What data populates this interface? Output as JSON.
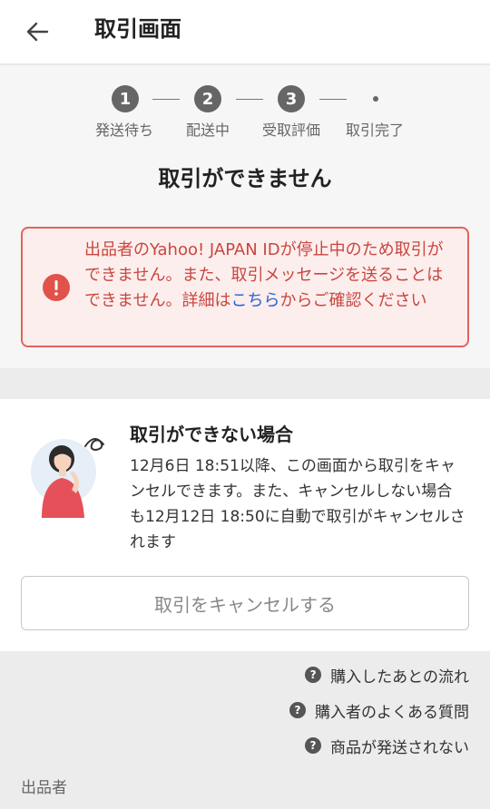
{
  "header": {
    "title": "取引画面"
  },
  "steps": [
    {
      "number": "1",
      "label": "発送待ち"
    },
    {
      "number": "2",
      "label": "配送中"
    },
    {
      "number": "3",
      "label": "受取評価"
    },
    {
      "number": "",
      "label": "取引完了"
    }
  ],
  "status_title": "取引ができません",
  "error": {
    "text_before": "出品者のYahoo! JAPAN IDが停止中のため取引ができません。また、取引メッセージを送ることはできません。詳細は",
    "link": "こちら",
    "text_after": "からご確認ください",
    "color": "#c9463f"
  },
  "cancel_card": {
    "title": "取引ができない場合",
    "description": "12月6日 18:51以降、この画面から取引をキャンセルできます。また、キャンセルしない場合も12月12日 18:50に自動で取引がキャンセルされます",
    "button_label": "取引をキャンセルする"
  },
  "help_links": [
    {
      "label": "購入したあとの流れ",
      "icon": "question-icon"
    },
    {
      "label": "購入者のよくある質問",
      "icon": "question-icon"
    },
    {
      "label": "商品が発送されない",
      "icon": "question-icon"
    }
  ],
  "seller_section_label": "出品者"
}
